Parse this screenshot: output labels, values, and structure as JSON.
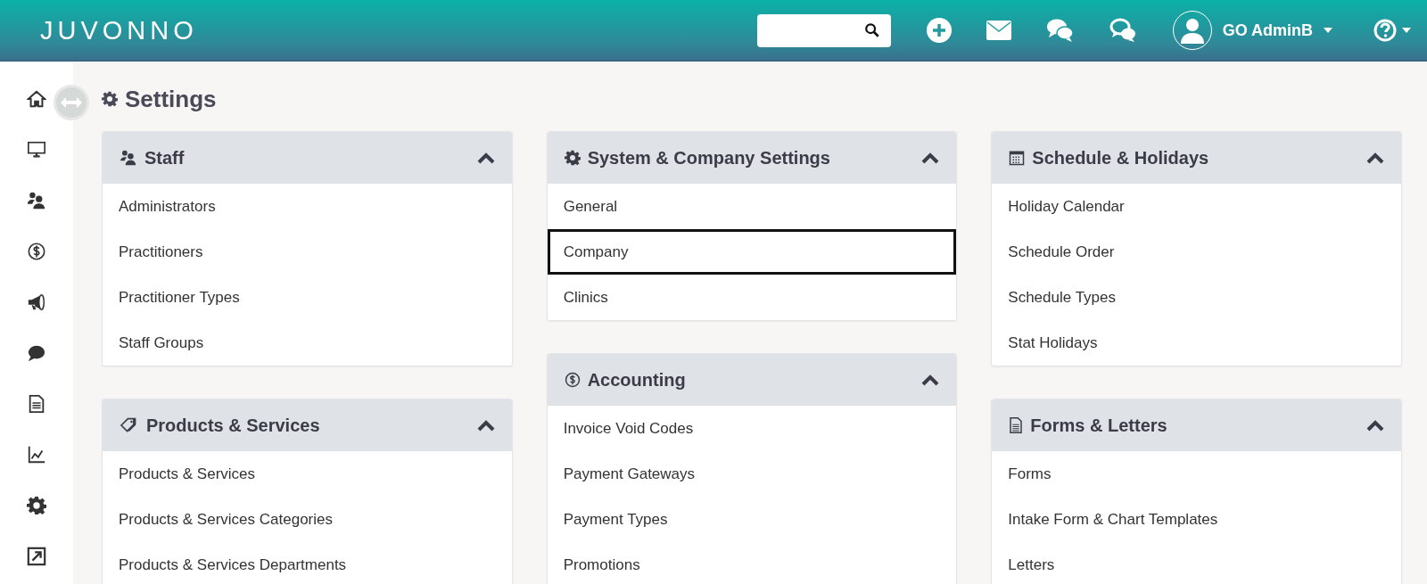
{
  "header": {
    "logo": "JUVONNO",
    "user": {
      "name": "GO AdminB"
    }
  },
  "page_title": "Settings",
  "columns": [
    {
      "panels": [
        {
          "title": "Staff",
          "expanded": true,
          "items": [
            {
              "label": "Administrators",
              "selected": false
            },
            {
              "label": "Practitioners",
              "selected": false
            },
            {
              "label": "Practitioner Types",
              "selected": false
            },
            {
              "label": "Staff Groups",
              "selected": false
            }
          ]
        },
        {
          "title": "Products & Services",
          "expanded": true,
          "items": [
            {
              "label": "Products & Services",
              "selected": false
            },
            {
              "label": "Products & Services Categories",
              "selected": false
            },
            {
              "label": "Products & Services Departments",
              "selected": false
            }
          ]
        }
      ]
    },
    {
      "panels": [
        {
          "title": "System & Company Settings",
          "expanded": true,
          "items": [
            {
              "label": "General",
              "selected": false
            },
            {
              "label": "Company",
              "selected": true
            },
            {
              "label": "Clinics",
              "selected": false
            }
          ]
        },
        {
          "title": "Accounting",
          "expanded": true,
          "items": [
            {
              "label": "Invoice Void Codes",
              "selected": false
            },
            {
              "label": "Payment Gateways",
              "selected": false
            },
            {
              "label": "Payment Types",
              "selected": false
            },
            {
              "label": "Promotions",
              "selected": false
            }
          ]
        }
      ]
    },
    {
      "panels": [
        {
          "title": "Schedule & Holidays",
          "expanded": true,
          "items": [
            {
              "label": "Holiday Calendar",
              "selected": false
            },
            {
              "label": "Schedule Order",
              "selected": false
            },
            {
              "label": "Schedule Types",
              "selected": false
            },
            {
              "label": "Stat Holidays",
              "selected": false
            }
          ]
        },
        {
          "title": "Forms & Letters",
          "expanded": true,
          "items": [
            {
              "label": "Forms",
              "selected": false
            },
            {
              "label": "Intake Form & Chart Templates",
              "selected": false
            },
            {
              "label": "Letters",
              "selected": false
            }
          ]
        }
      ]
    }
  ]
}
